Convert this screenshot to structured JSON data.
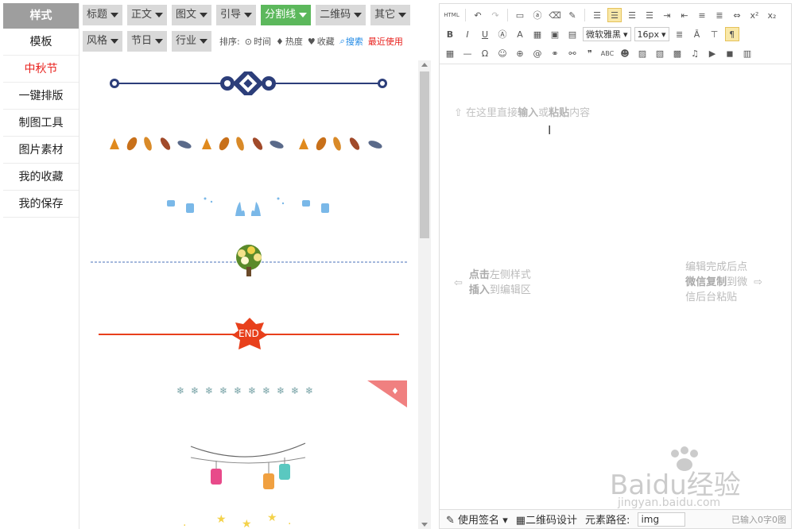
{
  "sidebar": {
    "header": "样式",
    "items": [
      {
        "label": "模板",
        "active": false
      },
      {
        "label": "中秋节",
        "active": true
      },
      {
        "label": "一键排版",
        "active": false
      },
      {
        "label": "制图工具",
        "active": false
      },
      {
        "label": "图片素材",
        "active": false
      },
      {
        "label": "我的收藏",
        "active": false
      },
      {
        "label": "我的保存",
        "active": false
      }
    ]
  },
  "categories": {
    "row1": [
      "标题",
      "正文",
      "图文",
      "引导",
      "分割线",
      "二维码",
      "其它"
    ],
    "row1_active": "分割线",
    "row2": [
      "风格",
      "节日",
      "行业"
    ],
    "sort_label": "排序:",
    "sort_options": [
      "时间",
      "热度",
      "收藏",
      "搜索"
    ],
    "recent": "最近使用"
  },
  "styles": {
    "end_label": "END"
  },
  "editor": {
    "font_family": "微软雅黑",
    "font_size": "16px",
    "html_label": "HTML",
    "placeholder_pre": "在这里直接",
    "placeholder_b1": "输入",
    "placeholder_mid": "或",
    "placeholder_b2": "粘贴",
    "placeholder_post": "内容",
    "hint_left_b1": "点击",
    "hint_left_1": "左侧样式",
    "hint_left_b2": "插入",
    "hint_left_2": "到编辑区",
    "hint_right_1": "编辑完成后点",
    "hint_right_b1": "微信复制",
    "hint_right_2": "到微",
    "hint_right_3": "信后台粘贴"
  },
  "statusbar": {
    "signature": "使用签名",
    "qrcode": "二维码设计",
    "path_label": "元素路径:",
    "path_value": "img",
    "count": "已输入0字0图"
  },
  "watermark": {
    "text": "Baidu经验",
    "url": "jingyan.baidu.com"
  },
  "colors": {
    "accent_green": "#5cb85c",
    "active_red": "#e8201c",
    "divider_blue": "#2c3e7a",
    "end_red": "#e8401c"
  }
}
